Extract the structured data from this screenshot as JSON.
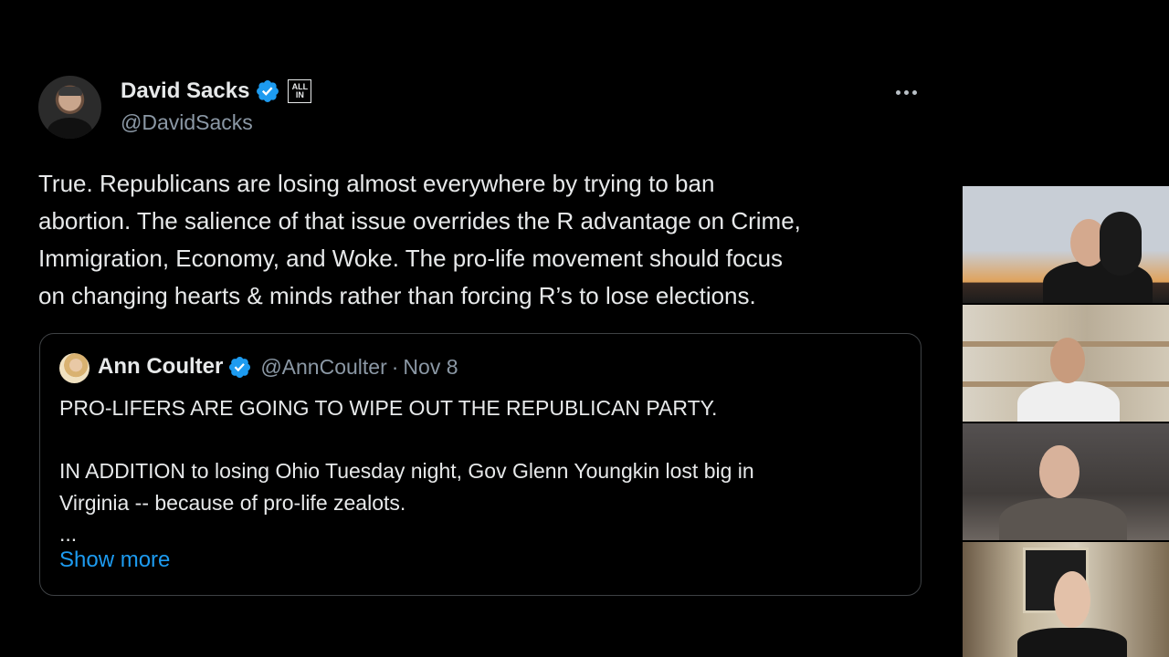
{
  "tweet": {
    "author_name": "David Sacks",
    "author_handle": "@DavidSacks",
    "affiliate_badge": [
      "ALL",
      "IN"
    ],
    "more_label": "More",
    "body_lines": [
      "True. Republicans are losing almost everywhere by trying to ban",
      "abortion. The salience of that issue overrides the R advantage on Crime,",
      "Immigration, Economy, and Woke. The pro-life movement should focus",
      "on changing hearts & minds rather than forcing R’s to lose elections."
    ]
  },
  "quoted_tweet": {
    "author_name": "Ann Coulter",
    "author_handle": "@AnnCoulter",
    "separator": "·",
    "date": "Nov 8",
    "text_lines": [
      "PRO-LIFERS ARE GOING TO WIPE OUT THE REPUBLICAN PARTY.",
      "",
      "IN ADDITION to losing Ohio Tuesday night, Gov Glenn Youngkin lost big in",
      "Virginia -- because of pro-life zealots.",
      "..."
    ],
    "show_more_label": "Show more"
  },
  "icons": {
    "verified": "verified-badge-icon",
    "more": "more-horizontal-icon"
  },
  "colors": {
    "background": "#000000",
    "text": "#e7e9ea",
    "secondary_text": "#8b98a5",
    "link": "#1d9bf0",
    "verified": "#1d9bf0",
    "border": "#3e4144"
  }
}
